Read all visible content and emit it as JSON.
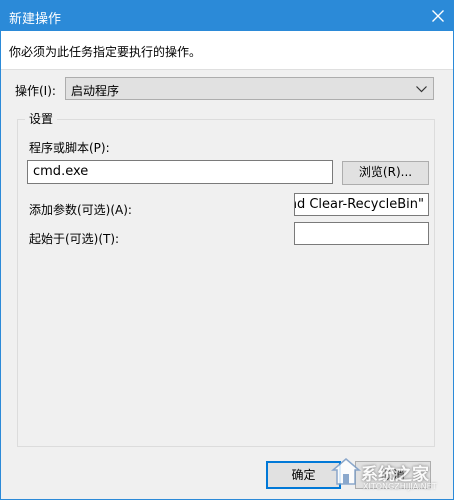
{
  "window": {
    "title": "新建操作",
    "description": "你必须为此任务指定要执行的操作。"
  },
  "action": {
    "label": "操作(I):",
    "selected": "启动程序"
  },
  "settings": {
    "group_title": "设置",
    "program_label": "程序或脚本(P):",
    "program_value": "cmd.exe",
    "browse_label": "浏览(R)...",
    "args_label": "添加参数(可选)(A):",
    "args_value": "mand Clear-RecycleBin\"",
    "start_in_label": "起始于(可选)(T):",
    "start_in_value": ""
  },
  "footer": {
    "ok_label": "确定",
    "cancel_label": "取消"
  },
  "watermark": {
    "text": "系统之家",
    "sub": "XITONGZHIJIA.NET"
  },
  "colors": {
    "titlebar": "#2b8ad8",
    "background": "#f0f0f0"
  }
}
